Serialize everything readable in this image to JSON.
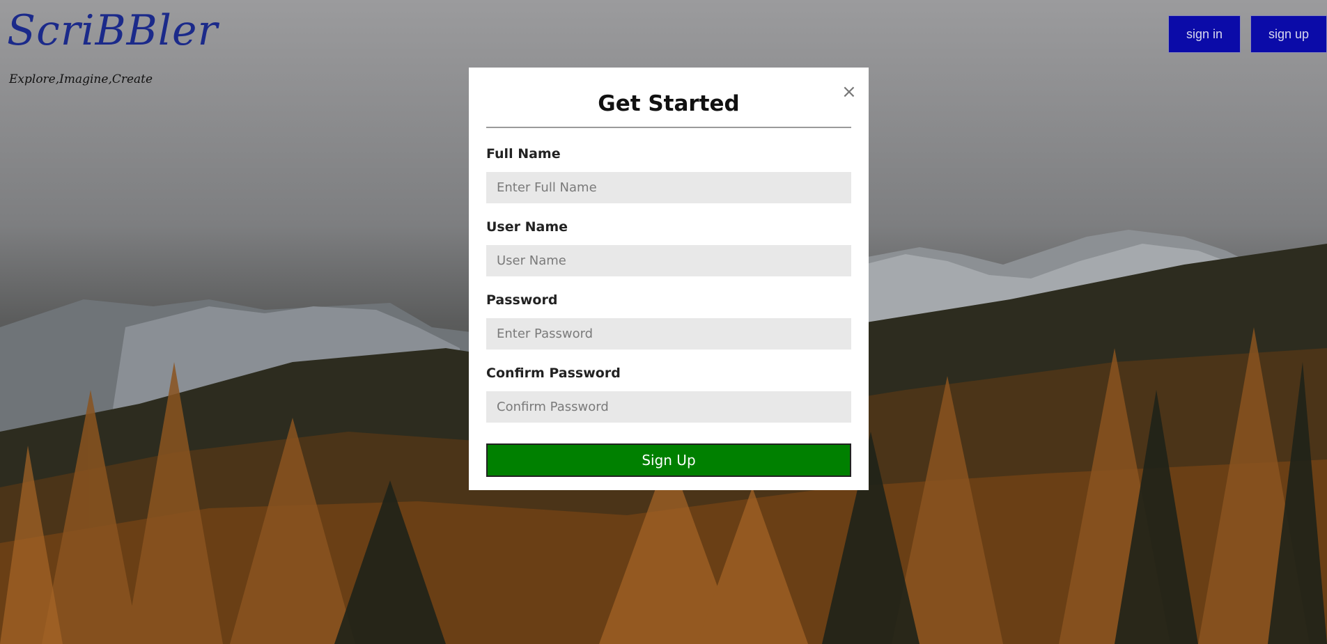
{
  "header": {
    "brand": "ScriBBler",
    "tagline": "Explore,Imagine,Create",
    "signin_label": "sign in",
    "signup_label": "sign up"
  },
  "modal": {
    "title": "Get Started",
    "close_glyph": "×",
    "fields": [
      {
        "label": "Full Name",
        "placeholder": "Enter Full Name",
        "value": ""
      },
      {
        "label": "User Name",
        "placeholder": "User Name",
        "value": ""
      },
      {
        "label": "Password",
        "placeholder": "Enter Password",
        "value": ""
      },
      {
        "label": "Confirm Password",
        "placeholder": "Confirm Password",
        "value": ""
      }
    ],
    "submit_label": "Sign Up"
  },
  "colors": {
    "brand": "#1b2a8a",
    "nav_button": "#0b0ba8",
    "submit_button": "#008000",
    "input_bg": "#e8e8e8"
  },
  "icons": {
    "close": "close-icon"
  }
}
